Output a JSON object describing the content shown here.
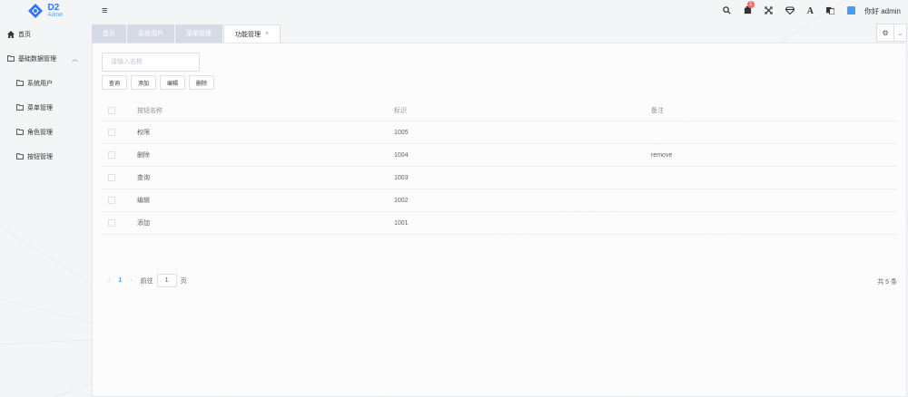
{
  "header": {
    "logo_title": "D2",
    "logo_subtitle": "Admin",
    "menu_toggle_glyph": "≡",
    "notification_count": "1",
    "user_greeting": "你好 admin",
    "icons": [
      "search-icon",
      "notification-icon",
      "fullscreen-icon",
      "theme-icon",
      "font-size-icon",
      "language-icon",
      "color-picker-icon"
    ]
  },
  "sidebar": {
    "items": [
      {
        "label": "首页",
        "icon": "home-icon"
      },
      {
        "label": "基础数据管理",
        "icon": "folder-icon",
        "expanded": true
      },
      {
        "label": "系统用户",
        "icon": "folder-icon"
      },
      {
        "label": "菜单管理",
        "icon": "folder-icon"
      },
      {
        "label": "角色管理",
        "icon": "folder-icon"
      },
      {
        "label": "按钮管理",
        "icon": "folder-icon"
      }
    ]
  },
  "tabs": [
    {
      "label": "首页"
    },
    {
      "label": "系统用户"
    },
    {
      "label": "菜单管理"
    },
    {
      "label": "功能管理",
      "active": true,
      "close": "×"
    }
  ],
  "tabs_controls": {
    "settings_glyph": "⚙",
    "dropdown_glyph": "⌄"
  },
  "toolbar": {
    "search_placeholder": "请输入名称",
    "query_label": "查询",
    "add_label": "添加",
    "edit_label": "编辑",
    "delete_label": "删除"
  },
  "table": {
    "headers": [
      "按钮名称",
      "标识",
      "备注"
    ],
    "rows": [
      {
        "name": "权限",
        "code": "1005",
        "remark": ""
      },
      {
        "name": "删除",
        "code": "1004",
        "remark": "remove"
      },
      {
        "name": "查询",
        "code": "1003",
        "remark": ""
      },
      {
        "name": "编辑",
        "code": "1002",
        "remark": ""
      },
      {
        "name": "添加",
        "code": "1001",
        "remark": ""
      }
    ]
  },
  "pagination": {
    "prev": "‹",
    "current_page": "1",
    "next": "›",
    "goto_label": "前往",
    "goto_value": "1",
    "page_suffix": "页",
    "total_text": "共 5 条"
  },
  "colors": {
    "accent": "#409eff",
    "badge": "#f56c6c",
    "tab_inactive": "#d4dbe6"
  }
}
